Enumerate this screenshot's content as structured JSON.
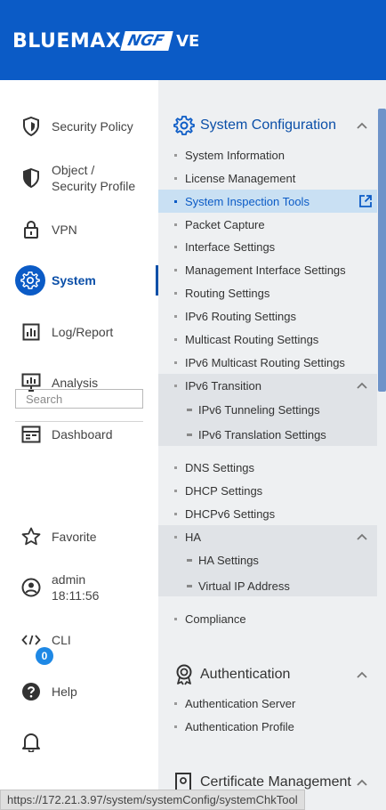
{
  "brand": {
    "main": "BLUEMAX",
    "ngf": "NGF",
    "ve": "VE"
  },
  "nav": {
    "security_policy": "Security Policy",
    "object_line1": "Object /",
    "object_line2": "Security Profile",
    "vpn": "VPN",
    "system": "System",
    "log_report": "Log/Report",
    "analysis": "Analysis",
    "dashboard": "Dashboard",
    "search_placeholder": "Search",
    "favorite": "Favorite",
    "admin_name": "admin",
    "admin_time": "18:11:56",
    "cli": "CLI",
    "help": "Help",
    "notification_count": "0"
  },
  "menu": {
    "system_configuration": {
      "title": "System Configuration",
      "items": [
        "System Information",
        "License Management",
        "System Inspection Tools",
        "Packet Capture",
        "Interface Settings",
        "Management Interface Settings",
        "Routing Settings",
        "IPv6 Routing Settings",
        "Multicast Routing Settings",
        "IPv6 Multicast Routing Settings"
      ],
      "selected": "System Inspection Tools",
      "ipv6_transition": {
        "title": "IPv6 Transition",
        "items": [
          "IPv6 Tunneling Settings",
          "IPv6 Translation Settings"
        ]
      },
      "items_after": [
        "DNS Settings",
        "DHCP Settings",
        "DHCPv6 Settings"
      ],
      "ha": {
        "title": "HA",
        "items": [
          "HA Settings",
          "Virtual IP Address"
        ]
      },
      "compliance": "Compliance"
    },
    "authentication": {
      "title": "Authentication",
      "items": [
        "Authentication Server",
        "Authentication Profile"
      ]
    },
    "certificate_management": {
      "title": "Certificate Management"
    }
  },
  "status_url": "https://172.21.3.97/system/systemConfig/systemChkTool",
  "colors": {
    "header": "#0b5bc6",
    "accent": "#0b4fa8",
    "selected_row": "#c9e0f3",
    "panel": "#eef0f2"
  }
}
